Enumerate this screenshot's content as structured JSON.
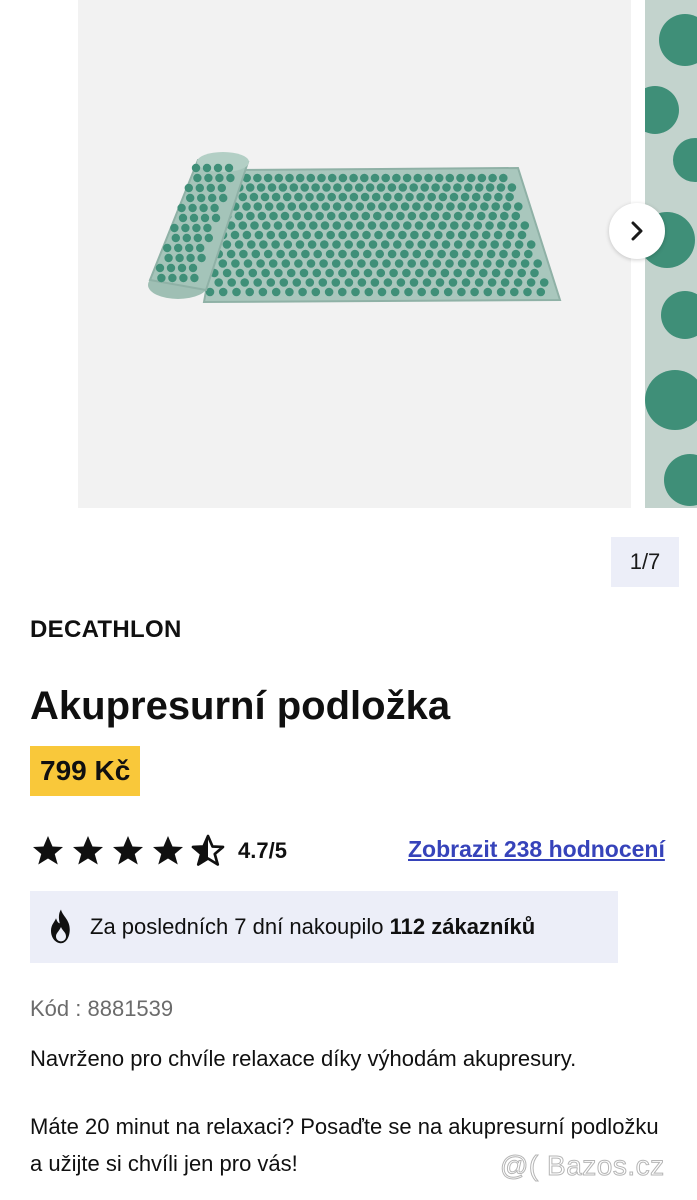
{
  "gallery": {
    "counter": "1/7",
    "next_icon": "chevron-right-icon"
  },
  "product": {
    "brand": "DECATHLON",
    "title": "Akupresurní podložka",
    "price": "799 Kč",
    "rating": {
      "value": 4.7,
      "max": 5,
      "text": "4.7/5",
      "reviews_link": "Zobrazit 238 hodnocení"
    },
    "buyers": {
      "icon": "fire-icon",
      "prefix": "Za posledních 7 dní nakoupilo ",
      "count": "112 zákazníků"
    },
    "code": "Kód : 8881539",
    "description1": "Navrženo pro chvíle relaxace díky výhodám akupresury.",
    "description2": "Máte 20 minut na relaxaci? Posaďte se na akupresurní podložku a užijte si chvíli jen pro vás!"
  },
  "watermark": "@( Bazos.cz",
  "colors": {
    "accent_link": "#3643ba",
    "price_bg": "#f9c83a",
    "info_bg": "#eceef8",
    "mat_green": "#3f8f78"
  }
}
